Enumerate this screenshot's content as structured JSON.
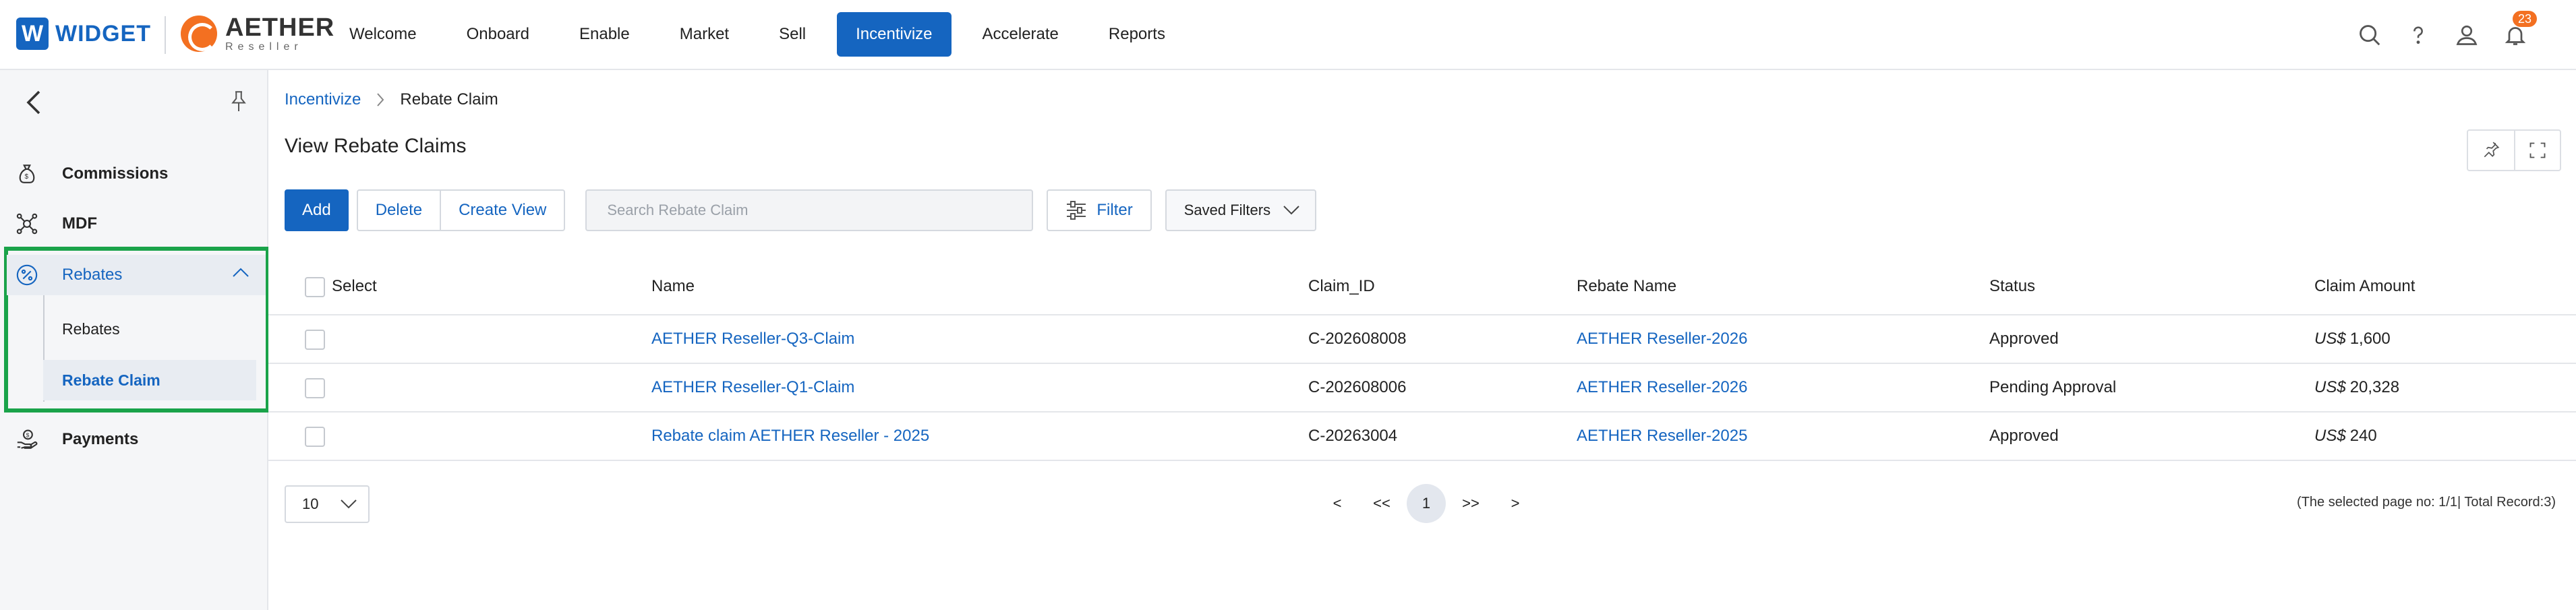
{
  "brand": {
    "widget_letter": "W",
    "widget_name": "WIDGET",
    "aether_name": "AETHER",
    "aether_sub": "Reseller"
  },
  "nav": {
    "items": [
      {
        "label": "Welcome"
      },
      {
        "label": "Onboard"
      },
      {
        "label": "Enable"
      },
      {
        "label": "Market"
      },
      {
        "label": "Sell"
      },
      {
        "label": "Incentivize"
      },
      {
        "label": "Accelerate"
      },
      {
        "label": "Reports"
      }
    ],
    "active": "Incentivize"
  },
  "top_icons": {
    "search_icon": "search-icon",
    "help_icon": "help-icon",
    "user_icon": "user-icon",
    "bell_icon": "bell-icon",
    "notification_count": "23"
  },
  "sidebar": {
    "items": [
      {
        "label": "Commissions",
        "icon": "money-bag-icon"
      },
      {
        "label": "MDF",
        "icon": "network-icon"
      },
      {
        "label": "Rebates",
        "icon": "percent-icon"
      },
      {
        "label": "Payments",
        "icon": "hand-coin-icon"
      }
    ],
    "rebates_sub": [
      {
        "label": "Rebates"
      },
      {
        "label": "Rebate Claim"
      }
    ]
  },
  "breadcrumb": {
    "parent": "Incentivize",
    "current": "Rebate Claim"
  },
  "page": {
    "title": "View Rebate Claims"
  },
  "toolbar": {
    "add_label": "Add",
    "delete_label": "Delete",
    "create_view_label": "Create View",
    "search_placeholder": "Search Rebate Claim",
    "filter_label": "Filter",
    "saved_filters_label": "Saved Filters"
  },
  "table": {
    "columns": [
      "Select",
      "Name",
      "Claim_ID",
      "Rebate Name",
      "Status",
      "Claim Amount"
    ],
    "rows": [
      {
        "name": "AETHER Reseller-Q3-Claim",
        "claim_id": "C-202608008",
        "rebate_name": "AETHER Reseller-2026",
        "status": "Approved",
        "currency": "US$",
        "amount": "1,600"
      },
      {
        "name": "AETHER Reseller-Q1-Claim",
        "claim_id": "C-202608006",
        "rebate_name": "AETHER Reseller-2026",
        "status": "Pending Approval",
        "currency": "US$",
        "amount": "20,328"
      },
      {
        "name": "Rebate claim AETHER Reseller - 2025",
        "claim_id": "C-20263004",
        "rebate_name": "AETHER Reseller-2025",
        "status": "Approved",
        "currency": "US$",
        "amount": "240"
      }
    ]
  },
  "pagination": {
    "page_size": "10",
    "prev": "<",
    "first": "<<",
    "current_page": "1",
    "last": ">>",
    "next": ">",
    "record_info": "(The selected page no: 1/1| Total Record:3)"
  },
  "colors": {
    "primary": "#1565c0",
    "accent_orange": "#f37021",
    "highlight_green": "#1aa34a"
  }
}
